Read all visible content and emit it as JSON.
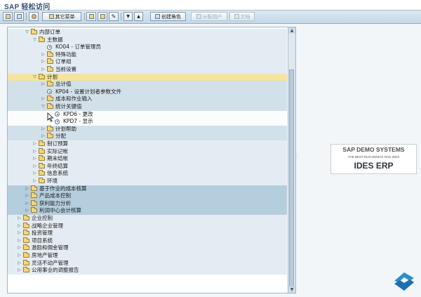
{
  "app": {
    "title": "SAP 轻松访问"
  },
  "toolbar": {
    "buttons": [
      {
        "label": ""
      },
      {
        "label": ""
      },
      {
        "label": ""
      },
      {
        "label": "其它菜单"
      },
      {
        "label": ""
      },
      {
        "label": ""
      },
      {
        "label": ""
      },
      {
        "label": ""
      },
      {
        "label": ""
      },
      {
        "label": "创建角色"
      },
      {
        "label": "分配用户"
      },
      {
        "label": "文档"
      }
    ]
  },
  "tree": {
    "rows": [
      {
        "label": "内部订单",
        "icon": "folder-icon",
        "expand": "open",
        "level": 0,
        "band": "b1"
      },
      {
        "label": "主数据",
        "icon": "folder-icon",
        "expand": "open",
        "level": 1,
        "band": "b1"
      },
      {
        "label": "KO04 - 订单管理员",
        "icon": "transaction-icon",
        "expand": "",
        "level": 2,
        "band": "b1"
      },
      {
        "label": "特殊功能",
        "icon": "folder-icon",
        "expand": "closed",
        "level": 2,
        "band": "b1"
      },
      {
        "label": "订单组",
        "icon": "folder-icon",
        "expand": "closed",
        "level": 2,
        "band": "b1"
      },
      {
        "label": "当前设置",
        "icon": "folder-icon",
        "expand": "closed",
        "level": 2,
        "band": "b1"
      },
      {
        "label": "计划",
        "icon": "folder-icon",
        "expand": "open",
        "level": 1,
        "band": "sel"
      },
      {
        "label": "总计值",
        "icon": "folder-icon",
        "expand": "closed",
        "level": 2,
        "band": "b2"
      },
      {
        "label": "KP04 - 设置计划者参数文件",
        "icon": "transaction-icon",
        "expand": "",
        "level": 2,
        "band": "b2"
      },
      {
        "label": "成本和作业输入",
        "icon": "folder-icon",
        "expand": "closed",
        "level": 2,
        "band": "b2"
      },
      {
        "label": "统计关键值",
        "icon": "folder-icon",
        "expand": "open",
        "level": 2,
        "band": "b2"
      },
      {
        "label": "KPD6 - 更改",
        "icon": "transaction-icon",
        "expand": "",
        "level": 3,
        "band": "b4"
      },
      {
        "label": "KPD7 - 显示",
        "icon": "transaction-icon",
        "expand": "",
        "level": 3,
        "band": "b4"
      },
      {
        "label": "计划帮助",
        "icon": "folder-icon",
        "expand": "closed",
        "level": 2,
        "band": "b2"
      },
      {
        "label": "分配",
        "icon": "folder-icon",
        "expand": "closed",
        "level": 2,
        "band": "b2"
      },
      {
        "label": "制订预算",
        "icon": "folder-icon",
        "expand": "closed",
        "level": 1,
        "band": "b1"
      },
      {
        "label": "实际记帐",
        "icon": "folder-icon",
        "expand": "closed",
        "level": 1,
        "band": "b1"
      },
      {
        "label": "期末结帐",
        "icon": "folder-icon",
        "expand": "closed",
        "level": 1,
        "band": "b1"
      },
      {
        "label": "年终结算",
        "icon": "folder-icon",
        "expand": "closed",
        "level": 1,
        "band": "b1"
      },
      {
        "label": "信息系统",
        "icon": "folder-icon",
        "expand": "closed",
        "level": 1,
        "band": "b1"
      },
      {
        "label": "环境",
        "icon": "folder-icon",
        "expand": "closed",
        "level": 1,
        "band": "b1"
      },
      {
        "label": "基于作业的成本核算",
        "icon": "folder-icon",
        "expand": "closed",
        "level": 0,
        "band": "b3"
      },
      {
        "label": "产品成本控制",
        "icon": "folder-icon",
        "expand": "closed",
        "level": 0,
        "band": "b3"
      },
      {
        "label": "获利能力分析",
        "icon": "folder-icon",
        "expand": "closed",
        "level": 0,
        "band": "b3"
      },
      {
        "label": "利润中心会计核算",
        "icon": "folder-icon",
        "expand": "closed",
        "level": 0,
        "band": "b3"
      },
      {
        "label": "企业控制",
        "icon": "folder-icon",
        "expand": "closed",
        "level": -1,
        "band": "b1"
      },
      {
        "label": "战略企业管理",
        "icon": "folder-icon",
        "expand": "closed",
        "level": -1,
        "band": "b1"
      },
      {
        "label": "投资管理",
        "icon": "folder-icon",
        "expand": "closed",
        "level": -1,
        "band": "b1"
      },
      {
        "label": "项目系统",
        "icon": "folder-icon",
        "expand": "closed",
        "level": -1,
        "band": "b1"
      },
      {
        "label": "激励和佣金管理",
        "icon": "folder-icon",
        "expand": "closed",
        "level": -1,
        "band": "b1"
      },
      {
        "label": "房地产管理",
        "icon": "folder-icon",
        "expand": "closed",
        "level": -1,
        "band": "b1"
      },
      {
        "label": "灵活不动产管理",
        "icon": "folder-icon",
        "expand": "closed",
        "level": -1,
        "band": "b1"
      },
      {
        "label": "公用事业的调整报告",
        "icon": "folder-icon",
        "expand": "closed",
        "level": -1,
        "band": "b1"
      }
    ]
  },
  "logo": {
    "line1": "SAP DEMO SYSTEMS",
    "line2": "THE BEST-RUN DEMOS RUN IDES",
    "line3": "IDES ERP"
  }
}
